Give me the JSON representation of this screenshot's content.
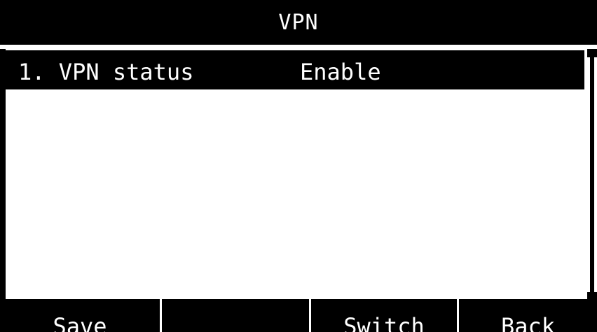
{
  "header": {
    "title": "VPN"
  },
  "menu": {
    "items": [
      {
        "index": "1.",
        "label": "VPN status",
        "value": "Enable",
        "selected": true
      }
    ]
  },
  "softkeys": [
    {
      "label": "Save"
    },
    {
      "label": ""
    },
    {
      "label": "Switch"
    },
    {
      "label": "Back"
    }
  ],
  "colors": {
    "foreground": "#000000",
    "background": "#ffffff"
  }
}
